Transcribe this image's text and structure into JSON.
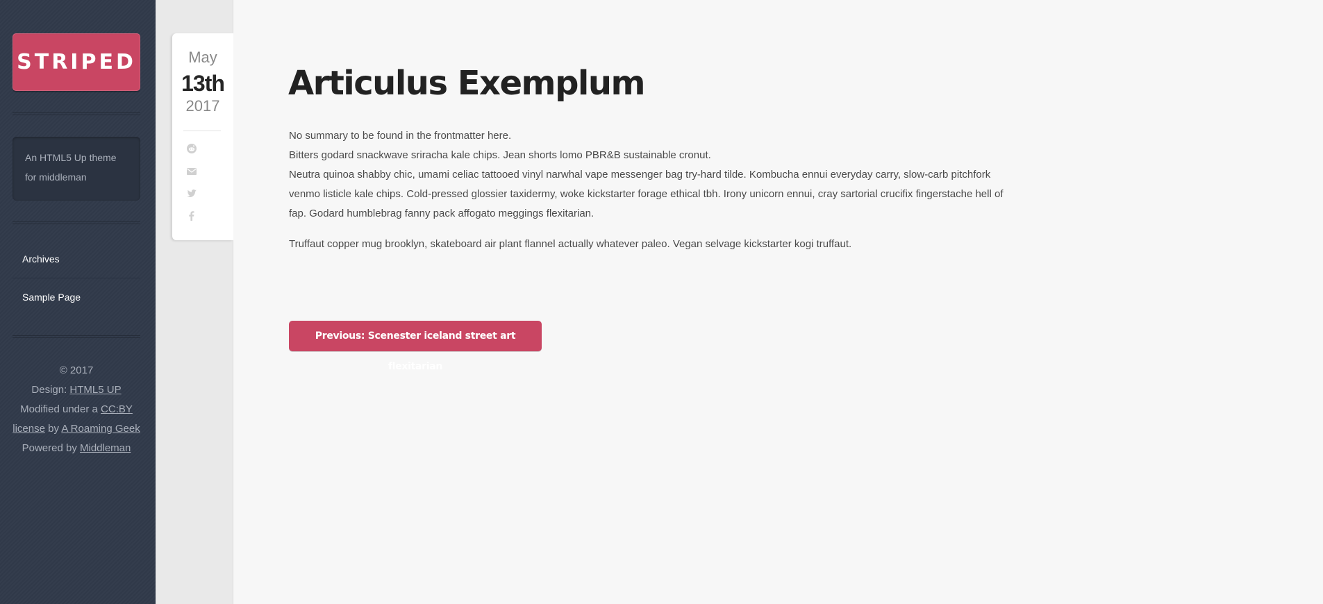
{
  "sidebar": {
    "logo": "STRIPED",
    "blurb": "An HTML5 Up theme for middleman",
    "nav": [
      {
        "label": "Archives"
      },
      {
        "label": "Sample Page"
      }
    ],
    "footer": {
      "copyright": "© 2017",
      "design_prefix": "Design: ",
      "design_link": "HTML5 UP",
      "modified_prefix": "Modified under a ",
      "license_link": "CC:BY license",
      "by_text": " by ",
      "author_link": "A Roaming Geek",
      "powered_prefix": "Powered by ",
      "powered_link": "Middleman"
    }
  },
  "date": {
    "month": "May",
    "day": "13th",
    "year": "2017"
  },
  "share_icons": [
    "reddit-icon",
    "envelope-icon",
    "twitter-icon",
    "facebook-icon"
  ],
  "post": {
    "title": "Articulus Exemplum",
    "paragraph1": [
      "No summary to be found in the frontmatter here.",
      "Bitters godard snackwave sriracha kale chips. Jean shorts lomo PBR&B sustainable cronut.",
      "Neutra quinoa shabby chic, umami celiac tattooed vinyl narwhal vape messenger bag try-hard tilde. Kombucha ennui everyday carry, slow-carb pitchfork venmo listicle kale chips. Cold-pressed glossier taxidermy, woke kickstarter forage ethical tbh. Irony unicorn ennui, cray sartorial crucifix fingerstache hell of fap. Godard humblebrag fanny pack affogato meggings flexitarian."
    ],
    "paragraph2": "Truffaut copper mug brooklyn, skateboard air plant flannel actually whatever paleo. Vegan selvage kickstarter kogi truffaut.",
    "previous_button": "Previous: Scenester iceland street art flexitarian"
  },
  "colors": {
    "accent": "#c94663",
    "sidebar_bg": "#313a4a"
  }
}
